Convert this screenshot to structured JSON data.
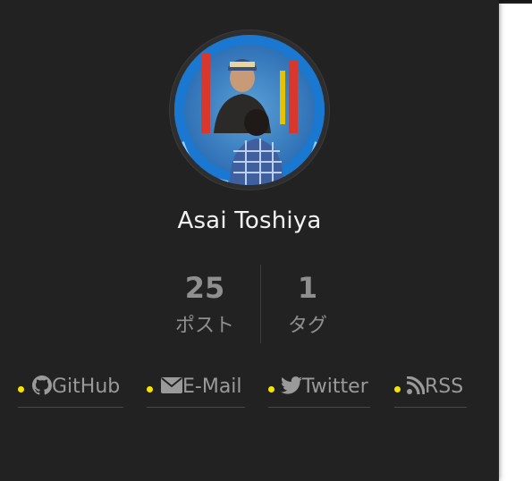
{
  "author": {
    "name": "Asai Toshiya"
  },
  "stats": [
    {
      "count": "25",
      "label": "ポスト"
    },
    {
      "count": "1",
      "label": "タグ"
    }
  ],
  "links": [
    {
      "label": "GitHub",
      "icon": "github-icon"
    },
    {
      "label": "E-Mail",
      "icon": "envelope-icon"
    },
    {
      "label": "Twitter",
      "icon": "twitter-icon"
    },
    {
      "label": "RSS",
      "icon": "rss-icon"
    }
  ],
  "colors": {
    "sidebar_bg": "#222222",
    "text_muted": "#9a9a9a",
    "dot": "#f5e500"
  }
}
